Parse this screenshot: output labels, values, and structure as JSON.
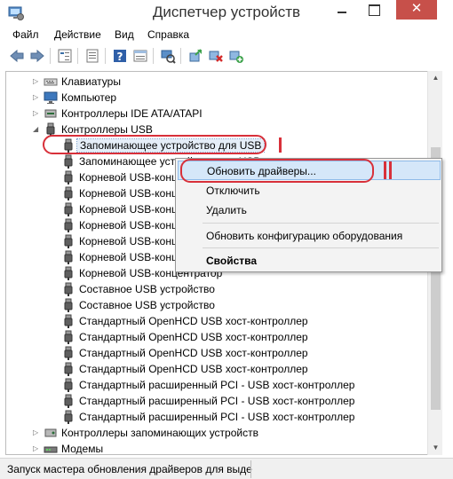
{
  "window": {
    "title": "Диспетчер устройств"
  },
  "menu": [
    "Файл",
    "Действие",
    "Вид",
    "Справка"
  ],
  "tree": [
    {
      "label": "Клавиатуры",
      "icon": "keyboard-icon",
      "expander": "▷"
    },
    {
      "label": "Компьютер",
      "icon": "computer-icon",
      "expander": "▷"
    },
    {
      "label": "Контроллеры IDE ATA/ATAPI",
      "icon": "ide-controller-icon",
      "expander": "▷"
    },
    {
      "label": "Контроллеры USB",
      "icon": "usb-plug-icon",
      "expander": "◢"
    },
    {
      "label": "Запоминающее устройство для USB",
      "icon": "usb-plug-icon",
      "selected": true
    },
    {
      "label": "Запоминающее устройство для USB",
      "icon": "usb-plug-icon"
    },
    {
      "label": "Корневой USB-концентратор",
      "icon": "usb-plug-icon"
    },
    {
      "label": "Корневой USB-концентратор",
      "icon": "usb-plug-icon"
    },
    {
      "label": "Корневой USB-концентратор",
      "icon": "usb-plug-icon"
    },
    {
      "label": "Корневой USB-концентратор",
      "icon": "usb-plug-icon"
    },
    {
      "label": "Корневой USB-концентратор",
      "icon": "usb-plug-icon"
    },
    {
      "label": "Корневой USB-концентратор",
      "icon": "usb-plug-icon"
    },
    {
      "label": "Корневой USB-концентратор",
      "icon": "usb-plug-icon"
    },
    {
      "label": "Составное USB устройство",
      "icon": "usb-plug-icon"
    },
    {
      "label": "Составное USB устройство",
      "icon": "usb-plug-icon"
    },
    {
      "label": "Стандартный OpenHCD USB хост-контроллер",
      "icon": "usb-plug-icon"
    },
    {
      "label": "Стандартный OpenHCD USB хост-контроллер",
      "icon": "usb-plug-icon"
    },
    {
      "label": "Стандартный OpenHCD USB хост-контроллер",
      "icon": "usb-plug-icon"
    },
    {
      "label": "Стандартный OpenHCD USB хост-контроллер",
      "icon": "usb-plug-icon"
    },
    {
      "label": "Стандартный расширенный PCI - USB хост-контроллер",
      "icon": "usb-plug-icon"
    },
    {
      "label": "Стандартный расширенный PCI - USB хост-контроллер",
      "icon": "usb-plug-icon"
    },
    {
      "label": "Стандартный расширенный PCI - USB хост-контроллер",
      "icon": "usb-plug-icon"
    },
    {
      "label": "Контроллеры запоминающих устройств",
      "icon": "storage-controller-icon",
      "expander": "▷"
    },
    {
      "label": "Модемы",
      "icon": "modem-icon",
      "expander": "▷"
    }
  ],
  "context_menu": {
    "update": "Обновить драйверы...",
    "disable": "Отключить",
    "remove": "Удалить",
    "scan": "Обновить конфигурацию оборудования",
    "properties": "Свойства"
  },
  "status": "Запуск мастера обновления драйверов для выде",
  "colors": {
    "accent_red": "#d8303a",
    "close_button": "#c7504a",
    "menu_highlight": "#d5e7f9"
  }
}
